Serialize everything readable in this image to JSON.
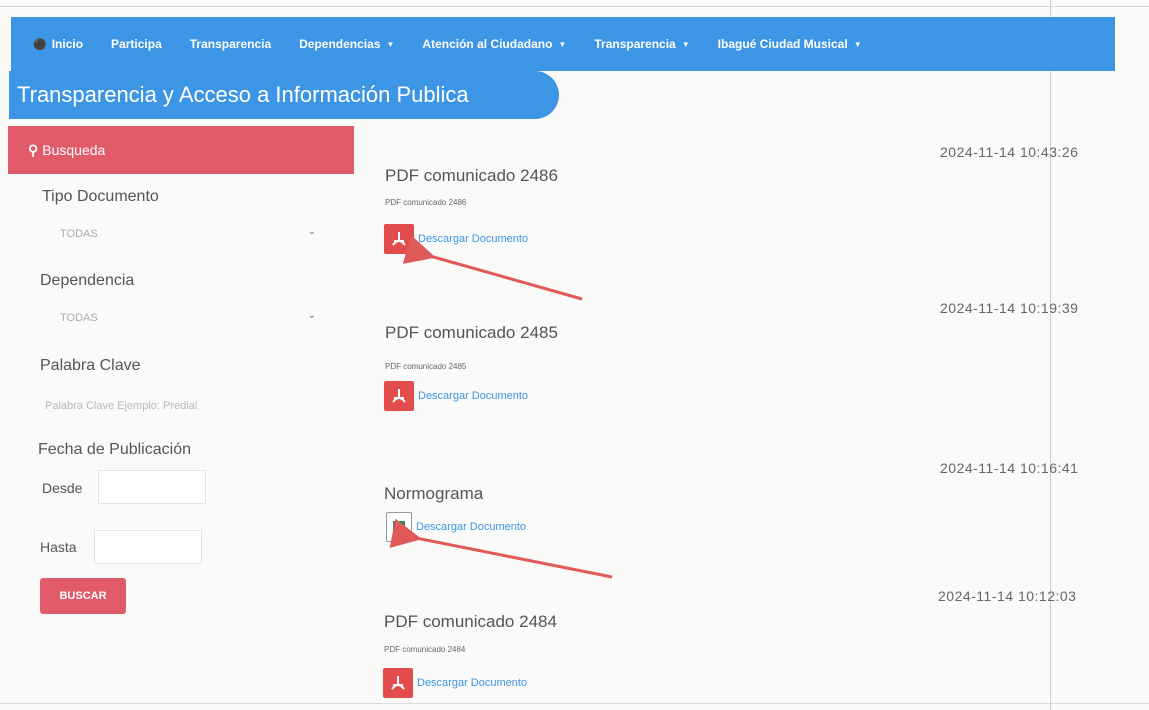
{
  "nav": {
    "items": [
      {
        "label": "Inicio",
        "icon": "home-icon",
        "dropdown": false
      },
      {
        "label": "Participa",
        "dropdown": false
      },
      {
        "label": "Transparencia",
        "dropdown": false
      },
      {
        "label": "Dependencias",
        "dropdown": true
      },
      {
        "label": "Atención al Ciudadano",
        "dropdown": true
      },
      {
        "label": "Transparencia",
        "dropdown": true
      },
      {
        "label": "Ibagué Ciudad Musical",
        "dropdown": true
      }
    ]
  },
  "page_title": "Transparencia y Acceso a Información Publica",
  "sidebar": {
    "search_header": "Busqueda",
    "tipo_documento_label": "Tipo Documento",
    "tipo_documento_value": "TODAS",
    "dependencia_label": "Dependencia",
    "dependencia_value": "TODAS",
    "palabra_clave_label": "Palabra Clave",
    "palabra_clave_placeholder": "Palabra Clave Ejemplo: Predial",
    "fecha_label": "Fecha de Publicación",
    "desde_label": "Desde",
    "hasta_label": "Hasta",
    "buscar_label": "BUSCAR"
  },
  "documents": [
    {
      "title": "PDF comunicado 2486",
      "subtitle": "PDF comunicado 2486",
      "date": "2024-11-14 10:43:26",
      "link": "Descargar Documento",
      "type": "pdf"
    },
    {
      "title": "PDF comunicado 2485",
      "subtitle": "PDF comunicado 2485",
      "date": "2024-11-14 10:19:39",
      "link": "Descargar Documento",
      "type": "pdf"
    },
    {
      "title": "Normograma",
      "subtitle": "",
      "date": "2024-11-14 10:16:41",
      "link": "Descargar Documento",
      "type": "xls"
    },
    {
      "title": "PDF comunicado 2484",
      "subtitle": "PDF comunicado 2484",
      "date": "2024-11-14 10:12:03",
      "link": "Descargar Documento",
      "type": "pdf"
    }
  ],
  "colors": {
    "nav_blue": "#3d95e6",
    "search_red": "#e05a6a",
    "arrow_red": "#e05a5a"
  }
}
